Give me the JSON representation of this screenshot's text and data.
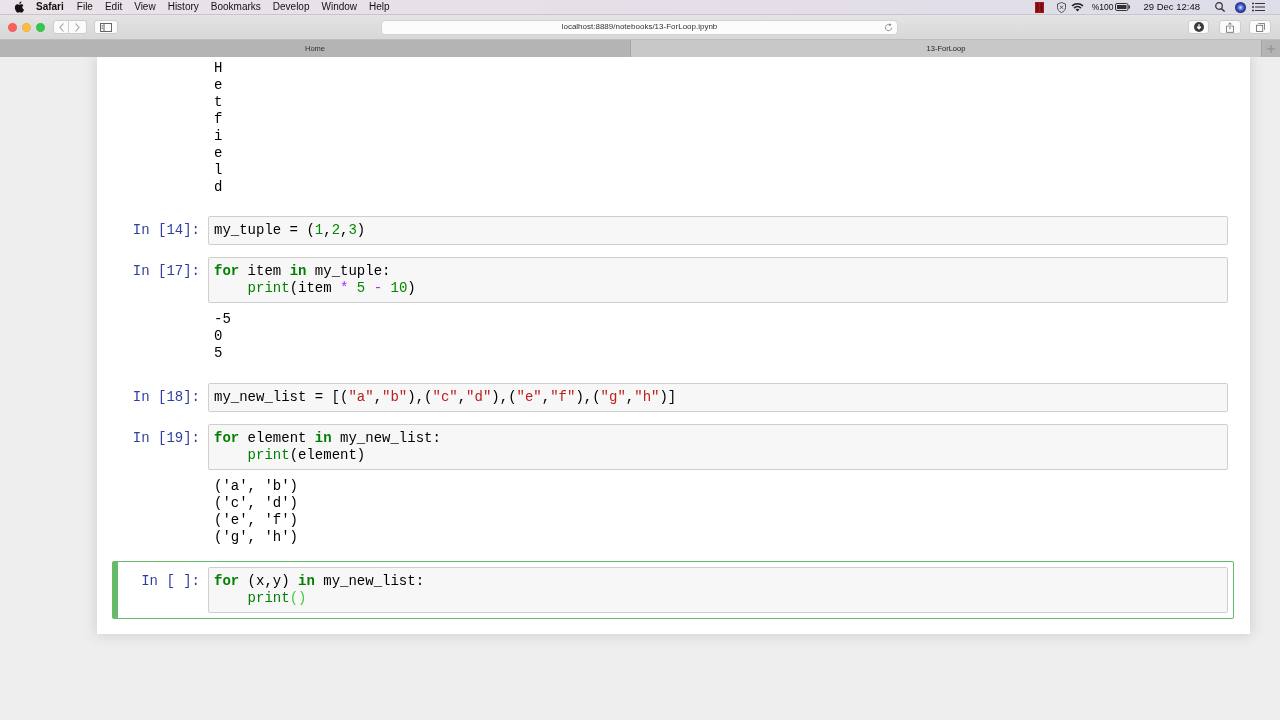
{
  "menubar": {
    "app": "Safari",
    "menus": [
      "File",
      "Edit",
      "View",
      "History",
      "Bookmarks",
      "Develop",
      "Window",
      "Help"
    ],
    "battery": "%100",
    "clock": "29 Dec 12:48"
  },
  "browser": {
    "url": "localhost:8889/notebooks/13-ForLoop.ipynb",
    "tabs": [
      {
        "label": "Home",
        "selected": false
      },
      {
        "label": "13-ForLoop",
        "selected": true
      }
    ]
  },
  "notebook": {
    "cells": [
      {
        "kind": "output",
        "selected": false,
        "outputs": [
          "H",
          "e",
          "t",
          "f",
          "i",
          "e",
          "l",
          "d"
        ]
      },
      {
        "kind": "code",
        "selected": false,
        "prompt": "In [14]:",
        "lines": [
          [
            {
              "text": "my_tuple = (",
              "kind": "plain"
            },
            {
              "text": "1",
              "kind": "number"
            },
            {
              "text": ",",
              "kind": "plain"
            },
            {
              "text": "2",
              "kind": "number"
            },
            {
              "text": ",",
              "kind": "plain"
            },
            {
              "text": "3",
              "kind": "number"
            },
            {
              "text": ")",
              "kind": "plain"
            }
          ]
        ]
      },
      {
        "kind": "code",
        "selected": false,
        "prompt": "In [17]:",
        "lines": [
          [
            {
              "text": "for",
              "kind": "keyword"
            },
            {
              "text": " item ",
              "kind": "plain"
            },
            {
              "text": "in",
              "kind": "keyword"
            },
            {
              "text": " my_tuple:",
              "kind": "plain"
            }
          ],
          [
            {
              "text": "    print",
              "kind": "builtin"
            },
            {
              "text": "(item ",
              "kind": "plain"
            },
            {
              "text": "*",
              "kind": "operator"
            },
            {
              "text": " 5",
              "kind": "number"
            },
            {
              "text": " -",
              "kind": "operator"
            },
            {
              "text": " 10",
              "kind": "number"
            },
            {
              "text": ")",
              "kind": "plain"
            }
          ]
        ],
        "outputs": [
          "-5",
          "0",
          "5"
        ]
      },
      {
        "kind": "code",
        "selected": false,
        "prompt": "In [18]:",
        "lines": [
          [
            {
              "text": "my_new_list = [(",
              "kind": "plain"
            },
            {
              "text": "\"a\"",
              "kind": "string"
            },
            {
              "text": ",",
              "kind": "plain"
            },
            {
              "text": "\"b\"",
              "kind": "string"
            },
            {
              "text": "),(",
              "kind": "plain"
            },
            {
              "text": "\"c\"",
              "kind": "string"
            },
            {
              "text": ",",
              "kind": "plain"
            },
            {
              "text": "\"d\"",
              "kind": "string"
            },
            {
              "text": "),(",
              "kind": "plain"
            },
            {
              "text": "\"e\"",
              "kind": "string"
            },
            {
              "text": ",",
              "kind": "plain"
            },
            {
              "text": "\"f\"",
              "kind": "string"
            },
            {
              "text": "),(",
              "kind": "plain"
            },
            {
              "text": "\"g\"",
              "kind": "string"
            },
            {
              "text": ",",
              "kind": "plain"
            },
            {
              "text": "\"h\"",
              "kind": "string"
            },
            {
              "text": ")]",
              "kind": "plain"
            }
          ]
        ]
      },
      {
        "kind": "code",
        "selected": false,
        "prompt": "In [19]:",
        "lines": [
          [
            {
              "text": "for",
              "kind": "keyword"
            },
            {
              "text": " element ",
              "kind": "plain"
            },
            {
              "text": "in",
              "kind": "keyword"
            },
            {
              "text": " my_new_list:",
              "kind": "plain"
            }
          ],
          [
            {
              "text": "    print",
              "kind": "builtin"
            },
            {
              "text": "(element)",
              "kind": "plain"
            }
          ]
        ],
        "outputs": [
          "('a', 'b')",
          "('c', 'd')",
          "('e', 'f')",
          "('g', 'h')"
        ]
      },
      {
        "kind": "code",
        "selected": true,
        "prompt": "In [ ]:",
        "lines": [
          [
            {
              "text": "for",
              "kind": "keyword"
            },
            {
              "text": " (x,y) ",
              "kind": "plain"
            },
            {
              "text": "in",
              "kind": "keyword"
            },
            {
              "text": " my_new_list:",
              "kind": "plain"
            }
          ],
          [
            {
              "text": "    print",
              "kind": "builtin"
            },
            {
              "text": "()",
              "kind": "match"
            }
          ]
        ]
      }
    ]
  }
}
